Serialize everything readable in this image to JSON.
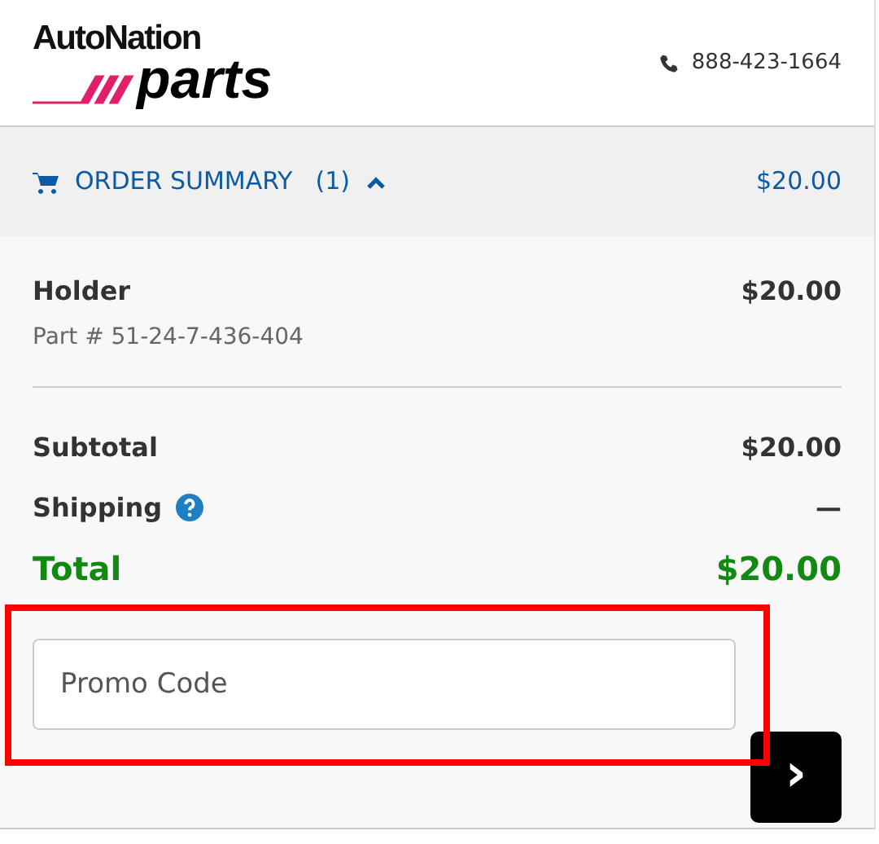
{
  "logo": {
    "top": "AutoNation",
    "bottom": "parts"
  },
  "phone": "888-423-1664",
  "summary_bar": {
    "title": "ORDER SUMMARY",
    "count": "(1)",
    "expanded": true,
    "total": "$20.00"
  },
  "items": [
    {
      "name": "Holder",
      "part": "Part # 51-24-7-436-404",
      "price": "$20.00"
    }
  ],
  "totals": [
    {
      "kind": "line",
      "label": "Subtotal",
      "value": "$20.00",
      "help": false
    },
    {
      "kind": "line",
      "label": "Shipping",
      "value": "—",
      "help": true
    },
    {
      "kind": "grand",
      "label": "Total",
      "value": "$20.00",
      "help": false
    }
  ],
  "promo": {
    "placeholder": "Promo Code",
    "highlighted": true
  },
  "apply_button": {
    "symbol": "›"
  }
}
